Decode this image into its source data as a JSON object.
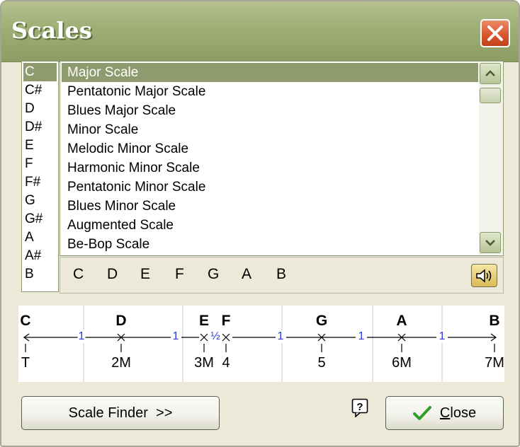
{
  "window": {
    "title": "Scales"
  },
  "notes": [
    "C",
    "C#",
    "D",
    "D#",
    "E",
    "F",
    "F#",
    "G",
    "G#",
    "A",
    "A#",
    "B"
  ],
  "selected_note": "C",
  "scales": [
    "Major Scale",
    "Pentatonic Major Scale",
    "Blues Major Scale",
    "Minor Scale",
    "Melodic Minor Scale",
    "Harmonic Minor Scale",
    "Pentatonic Minor Scale",
    "Blues Minor Scale",
    "Augmented Scale",
    "Be-Bop Scale"
  ],
  "selected_scale": "Major Scale",
  "scale_notes": [
    "C",
    "D",
    "E",
    "F",
    "G",
    "A",
    "B"
  ],
  "diagram": {
    "notes": [
      "C",
      "D",
      "E",
      "F",
      "G",
      "A",
      "B"
    ],
    "steps": [
      "1",
      "1",
      "½",
      "1",
      "1",
      "1"
    ],
    "intervals": [
      "T",
      "2M",
      "3M",
      "4",
      "5",
      "6M",
      "7M"
    ]
  },
  "buttons": {
    "scale_finder": "Scale Finder  >>",
    "close_letter": "C",
    "close_rest": "lose"
  },
  "icons": {
    "close": "close-icon",
    "scroll_up": "scroll-up-arrow-icon",
    "scroll_down": "scroll-down-arrow-icon",
    "speaker": "speaker-icon",
    "help": "help-icon",
    "check": "checkmark-icon"
  },
  "colors": {
    "selection": "#8f9a6e",
    "titlebar": "#9eae75",
    "close_button": "#d65429",
    "step_number": "#2b3bd8"
  }
}
